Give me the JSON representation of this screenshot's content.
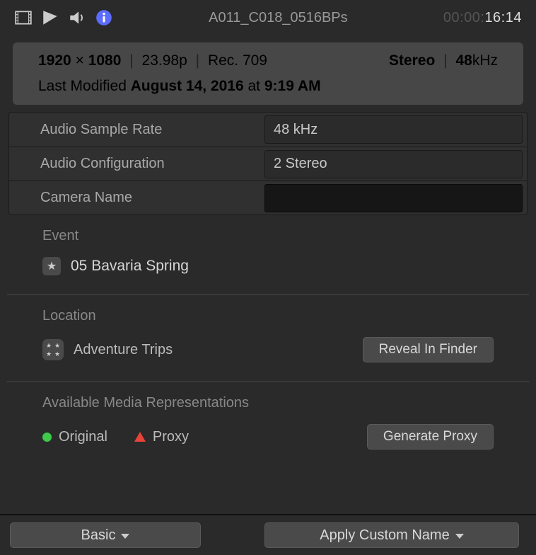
{
  "toolbar": {
    "clip_name": "A011_C018_0516BPs",
    "timecode_dim": "00:00:",
    "timecode_active": "16:14"
  },
  "summary": {
    "resolution_w": "1920",
    "resolution_h": "1080",
    "times": "×",
    "frame_rate": "23.98p",
    "colorspace": "Rec. 709",
    "audio_channels": "Stereo",
    "audio_rate_value": "48",
    "audio_rate_unit": "kHz",
    "modified_prefix": "Last Modified ",
    "modified_date": "August 14, 2016",
    "modified_at": " at ",
    "modified_time": "9:19 AM"
  },
  "props": {
    "sample_rate": {
      "label": "Audio Sample Rate",
      "value": "48 kHz"
    },
    "config": {
      "label": "Audio Configuration",
      "value": "2 Stereo"
    },
    "camera": {
      "label": "Camera Name",
      "value": ""
    }
  },
  "event": {
    "heading": "Event",
    "name": "05 Bavaria Spring"
  },
  "location": {
    "heading": "Location",
    "name": "Adventure Trips",
    "reveal_label": "Reveal In Finder"
  },
  "media": {
    "heading": "Available Media Representations",
    "original_label": "Original",
    "proxy_label": "Proxy",
    "generate_label": "Generate Proxy"
  },
  "footer": {
    "basic_label": "Basic",
    "apply_label": "Apply Custom Name"
  }
}
